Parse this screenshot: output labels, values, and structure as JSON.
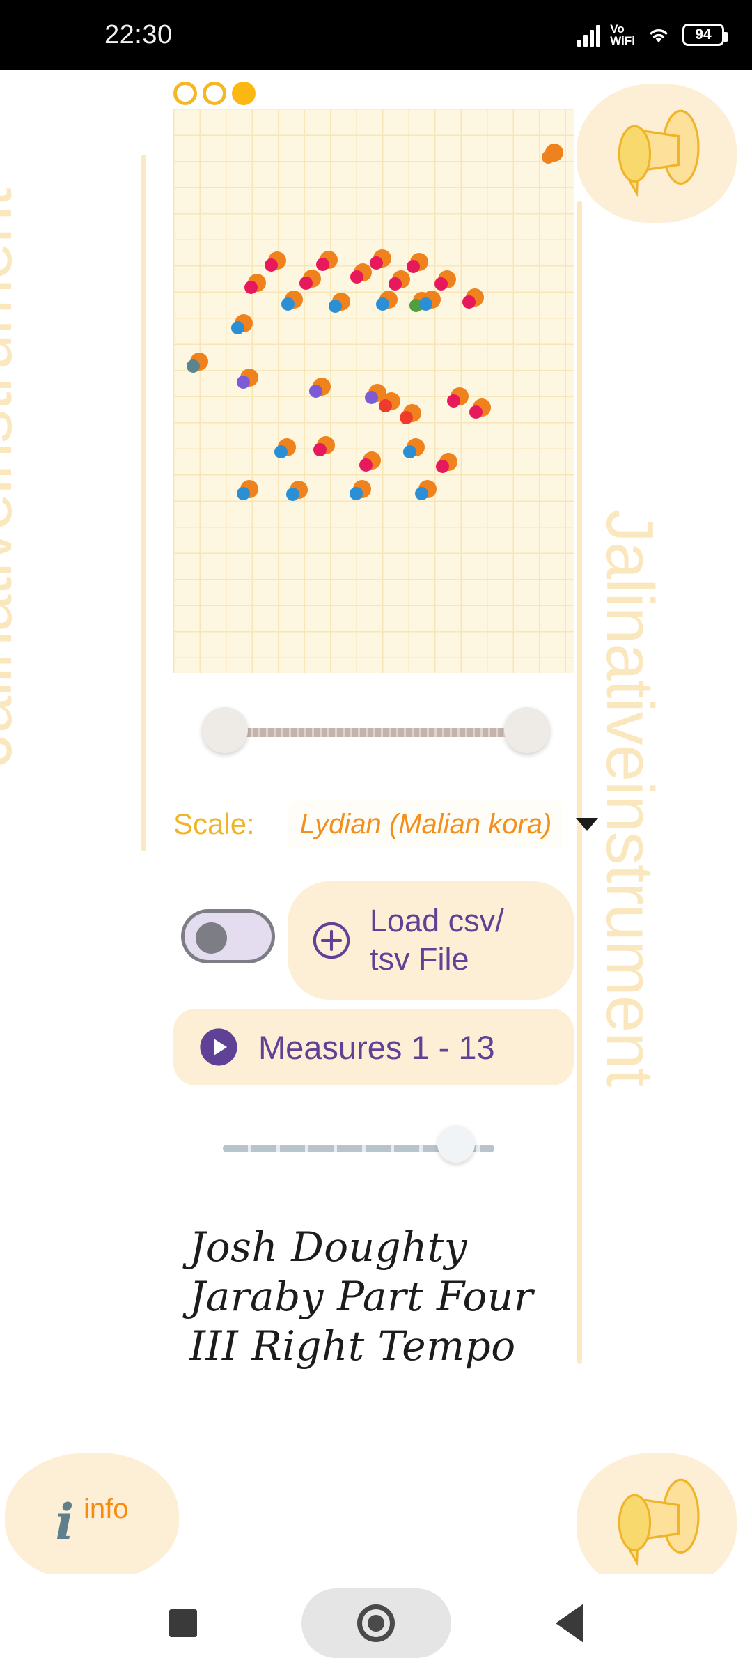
{
  "status_bar": {
    "time": "22:30",
    "network_label": "Vo",
    "network_label2": "WiFi",
    "battery": "94",
    "icons": [
      "signal-bars-icon",
      "vowifi-icon",
      "wifi-icon",
      "battery-icon"
    ]
  },
  "app": {
    "watermark_title": "Jalinativeinstrument"
  },
  "indicators": [
    {
      "name": "indicator-1",
      "state": "hollow"
    },
    {
      "name": "indicator-2",
      "state": "hollow"
    },
    {
      "name": "indicator-3",
      "state": "filled"
    }
  ],
  "colors": {
    "amber": "#f5b824",
    "gold_filled": "#fcb713",
    "orange": "#f0821e",
    "purple": "#5f4296",
    "cream": "#fdeed6",
    "grid_bg": "#fdf6e0",
    "grid_line": "#f7e6b8",
    "watermark": "#fbe7bd",
    "crimson": "#e8185d",
    "blue": "#2b8fd6",
    "teal": "#5a8590",
    "violet": "#7b5cd6",
    "red": "#ef3b2c",
    "green": "#4f9e3f"
  },
  "range_slider": {
    "name": "measure-range-slider",
    "low_percent": 0,
    "high_percent": 100
  },
  "scale": {
    "label": "Scale:",
    "value": "Lydian (Malian kora)",
    "caret": "chevron-down-icon"
  },
  "toggle": {
    "name": "mode-toggle",
    "state": "off"
  },
  "load_button": {
    "icon": "plus-circle-icon",
    "line1": "Load csv/",
    "line2": "tsv File"
  },
  "measures_button": {
    "icon": "play-circle-icon",
    "label": "Measures 1 - 13"
  },
  "tempo_slider": {
    "name": "tempo-slider",
    "value_percent": 86
  },
  "credits": {
    "line1": "Josh Doughty",
    "line2": "Jaraby Part Four",
    "line3": "III Right Tempo"
  },
  "info_button": {
    "icon": "info-italic-icon",
    "label": "info"
  },
  "instrument_badges": {
    "top": "kora-instrument-icon",
    "bottom": "kora-instrument-icon"
  },
  "nav_bar": {
    "recent": "square-recents-icon",
    "home": "home-circle-icon",
    "back": "back-triangle-icon"
  },
  "chart_data": {
    "type": "scatter",
    "title": "",
    "xlabel": "",
    "ylabel": "",
    "xlim": [
      0,
      575
    ],
    "ylim": [
      0,
      810
    ],
    "grid": true,
    "grid_spacing": 37.5,
    "legend": "none",
    "points": [
      {
        "x": 534,
        "y": 50,
        "inner": "orange"
      },
      {
        "x": 88,
        "y": 295,
        "inner": "blue"
      },
      {
        "x": 107,
        "y": 237,
        "inner": "crimson"
      },
      {
        "x": 136,
        "y": 205,
        "inner": "crimson"
      },
      {
        "x": 160,
        "y": 261,
        "inner": "blue"
      },
      {
        "x": 186,
        "y": 231,
        "inner": "crimson"
      },
      {
        "x": 210,
        "y": 204,
        "inner": "crimson"
      },
      {
        "x": 228,
        "y": 264,
        "inner": "blue"
      },
      {
        "x": 259,
        "y": 222,
        "inner": "crimson"
      },
      {
        "x": 287,
        "y": 202,
        "inner": "crimson"
      },
      {
        "x": 296,
        "y": 261,
        "inner": "blue"
      },
      {
        "x": 314,
        "y": 232,
        "inner": "crimson"
      },
      {
        "x": 340,
        "y": 207,
        "inner": "crimson"
      },
      {
        "x": 344,
        "y": 263,
        "inner": "green"
      },
      {
        "x": 358,
        "y": 261,
        "inner": "blue"
      },
      {
        "x": 380,
        "y": 232,
        "inner": "crimson"
      },
      {
        "x": 420,
        "y": 258,
        "inner": "crimson"
      },
      {
        "x": 24,
        "y": 350,
        "inner": "teal"
      },
      {
        "x": 96,
        "y": 373,
        "inner": "violet"
      },
      {
        "x": 200,
        "y": 386,
        "inner": "violet"
      },
      {
        "x": 280,
        "y": 395,
        "inner": "violet"
      },
      {
        "x": 300,
        "y": 407,
        "inner": "red"
      },
      {
        "x": 330,
        "y": 424,
        "inner": "red"
      },
      {
        "x": 398,
        "y": 400,
        "inner": "crimson"
      },
      {
        "x": 430,
        "y": 416,
        "inner": "crimson"
      },
      {
        "x": 150,
        "y": 473,
        "inner": "blue"
      },
      {
        "x": 206,
        "y": 470,
        "inner": "crimson"
      },
      {
        "x": 272,
        "y": 492,
        "inner": "crimson"
      },
      {
        "x": 335,
        "y": 473,
        "inner": "blue"
      },
      {
        "x": 382,
        "y": 494,
        "inner": "crimson"
      },
      {
        "x": 96,
        "y": 533,
        "inner": "blue"
      },
      {
        "x": 167,
        "y": 534,
        "inner": "blue"
      },
      {
        "x": 258,
        "y": 533,
        "inner": "blue"
      },
      {
        "x": 352,
        "y": 533,
        "inner": "blue"
      }
    ],
    "series_colors": {
      "outer": "#f0821e",
      "inner_variants": [
        "crimson",
        "blue",
        "teal",
        "violet",
        "red",
        "green",
        "orange"
      ]
    }
  }
}
